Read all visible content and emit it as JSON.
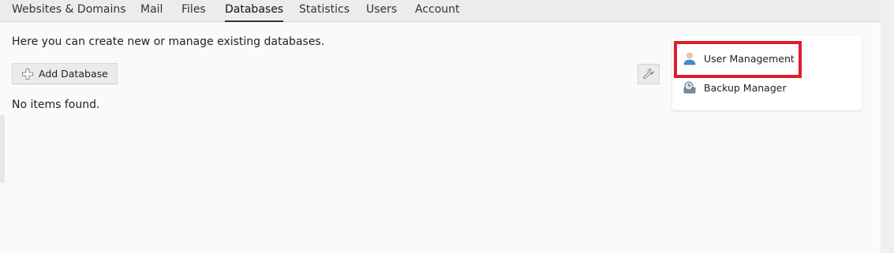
{
  "tabs": [
    {
      "label": "Websites & Domains",
      "active": false
    },
    {
      "label": "Mail",
      "active": false
    },
    {
      "label": "Files",
      "active": false
    },
    {
      "label": "Databases",
      "active": true
    },
    {
      "label": "Statistics",
      "active": false
    },
    {
      "label": "Users",
      "active": false
    },
    {
      "label": "Account",
      "active": false
    }
  ],
  "main": {
    "description": "Here you can create new or manage existing databases.",
    "add_button": {
      "label": "Add Database",
      "icon": "plus-icon"
    },
    "settings_button": {
      "icon": "wrench-icon"
    },
    "empty_message": "No items found."
  },
  "side_panel": {
    "links": [
      {
        "label": "User Management",
        "icon": "user-icon"
      },
      {
        "label": "Backup Manager",
        "icon": "backup-icon"
      }
    ]
  },
  "colors": {
    "highlight": "#e21b2a",
    "user_icon": "#3f8fd2"
  }
}
